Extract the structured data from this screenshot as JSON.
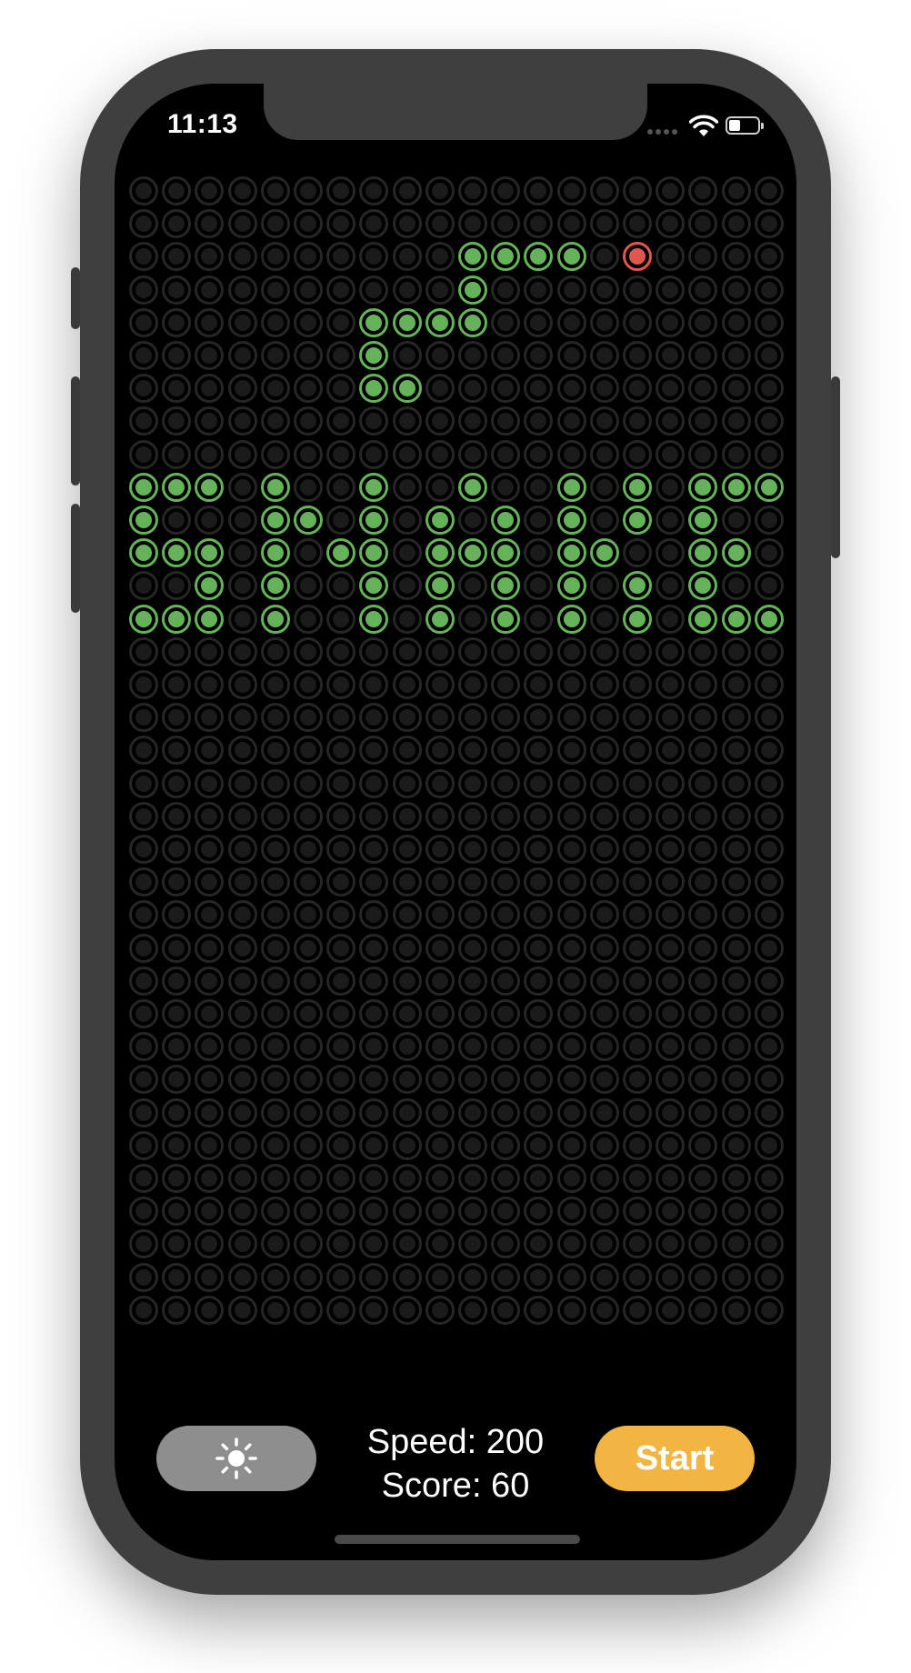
{
  "status_bar": {
    "time": "11:13",
    "wifi_icon": "wifi-icon",
    "battery_icon": "battery-icon",
    "battery_level": 0.25
  },
  "board": {
    "columns": 20,
    "rows": 35,
    "snake_color": "#66b25a",
    "food_color": "#e0574f",
    "off_color": "#1b1b1b",
    "lit_cells": [
      [
        2,
        10
      ],
      [
        2,
        11
      ],
      [
        2,
        12
      ],
      [
        2,
        13
      ],
      [
        3,
        10
      ],
      [
        4,
        7
      ],
      [
        4,
        8
      ],
      [
        4,
        9
      ],
      [
        4,
        10
      ],
      [
        5,
        7
      ],
      [
        6,
        7
      ],
      [
        6,
        8
      ],
      [
        9,
        0
      ],
      [
        9,
        1
      ],
      [
        9,
        2
      ],
      [
        9,
        4
      ],
      [
        9,
        7
      ],
      [
        9,
        10
      ],
      [
        9,
        13
      ],
      [
        9,
        15
      ],
      [
        9,
        17
      ],
      [
        9,
        18
      ],
      [
        9,
        19
      ],
      [
        10,
        0
      ],
      [
        10,
        4
      ],
      [
        10,
        5
      ],
      [
        10,
        7
      ],
      [
        10,
        9
      ],
      [
        10,
        11
      ],
      [
        10,
        13
      ],
      [
        10,
        15
      ],
      [
        10,
        17
      ],
      [
        11,
        0
      ],
      [
        11,
        1
      ],
      [
        11,
        2
      ],
      [
        11,
        4
      ],
      [
        11,
        6
      ],
      [
        11,
        7
      ],
      [
        11,
        9
      ],
      [
        11,
        10
      ],
      [
        11,
        11
      ],
      [
        11,
        13
      ],
      [
        11,
        14
      ],
      [
        11,
        17
      ],
      [
        11,
        18
      ],
      [
        12,
        2
      ],
      [
        12,
        4
      ],
      [
        12,
        7
      ],
      [
        12,
        9
      ],
      [
        12,
        11
      ],
      [
        12,
        13
      ],
      [
        12,
        15
      ],
      [
        12,
        17
      ],
      [
        13,
        0
      ],
      [
        13,
        1
      ],
      [
        13,
        2
      ],
      [
        13,
        4
      ],
      [
        13,
        7
      ],
      [
        13,
        9
      ],
      [
        13,
        11
      ],
      [
        13,
        13
      ],
      [
        13,
        15
      ],
      [
        13,
        17
      ],
      [
        13,
        18
      ],
      [
        13,
        19
      ]
    ],
    "food_cells": [
      [
        2,
        15
      ]
    ]
  },
  "controls": {
    "theme_icon": "sun-icon",
    "speed_text": "Speed: 200",
    "score_text": "Score: 60",
    "start_label": "Start"
  }
}
